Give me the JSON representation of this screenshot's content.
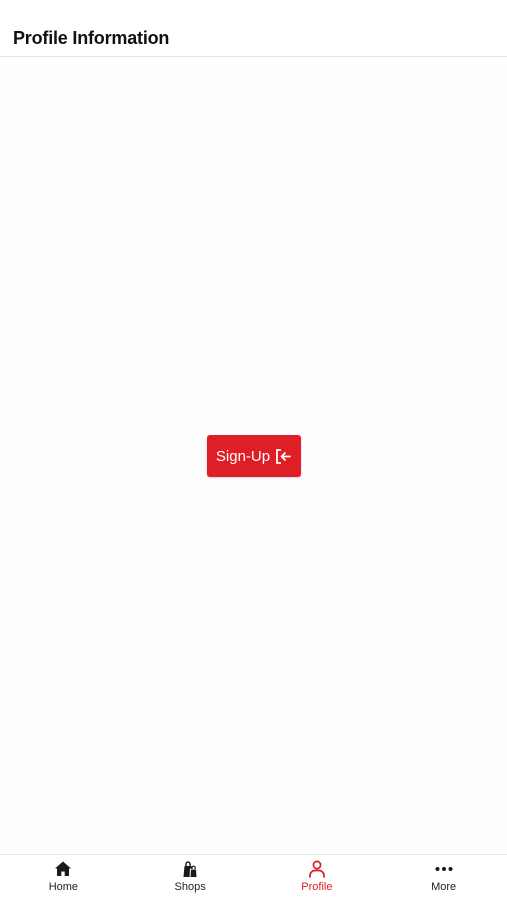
{
  "header": {
    "title": "Profile Information"
  },
  "main": {
    "signup_label": "Sign-Up",
    "signup_icon": "login-arrow-icon"
  },
  "bottom_nav": {
    "active_color": "#df1f26",
    "items": [
      {
        "label": "Home",
        "icon": "home-icon"
      },
      {
        "label": "Shops",
        "icon": "shopping-bags-icon"
      },
      {
        "label": "Profile",
        "icon": "user-icon",
        "active": true
      },
      {
        "label": "More",
        "icon": "more-dots-icon"
      }
    ]
  },
  "colors": {
    "accent": "#df1f26",
    "text": "#111111"
  }
}
